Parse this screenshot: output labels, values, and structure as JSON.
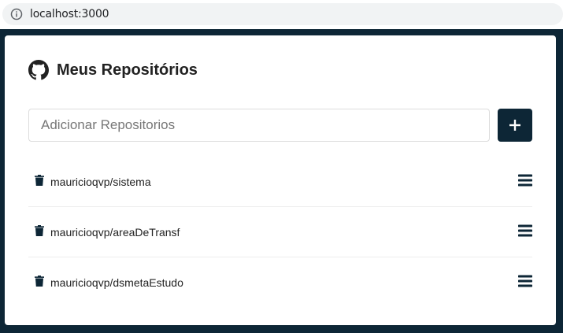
{
  "browser": {
    "url": "localhost:3000",
    "info_icon": "info-icon"
  },
  "header": {
    "icon": "github-icon",
    "title": "Meus Repositórios"
  },
  "form": {
    "placeholder": "Adicionar Repositorios",
    "value": "",
    "add_icon": "plus-icon"
  },
  "repositories": [
    {
      "name": "mauricioqvp/sistema"
    },
    {
      "name": "mauricioqvp/areaDeTransf"
    },
    {
      "name": "mauricioqvp/dsmetaEstudo"
    }
  ],
  "colors": {
    "primary": "#0d2636",
    "background": "#0d2636",
    "card": "#ffffff"
  }
}
